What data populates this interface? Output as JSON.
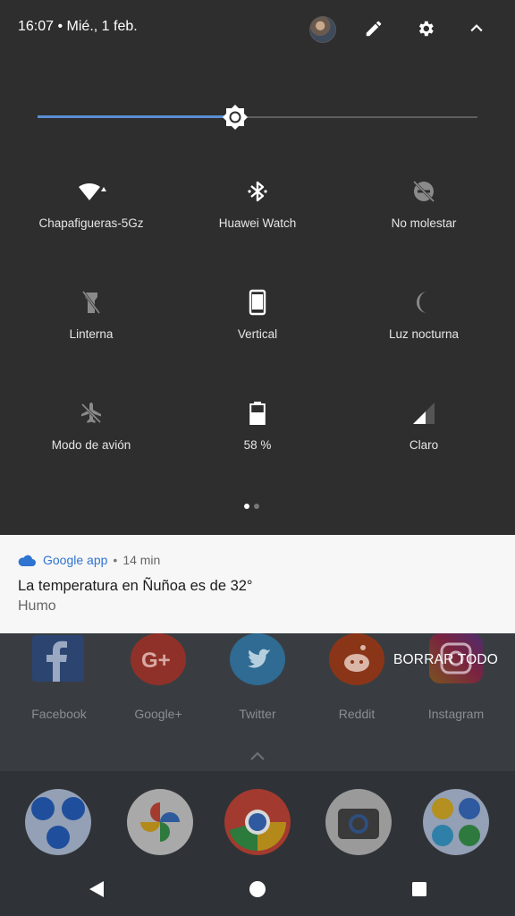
{
  "status_bar": {
    "time_date": "16:07 • Mié., 1 feb."
  },
  "brightness": {
    "level": 0.45
  },
  "tiles": [
    {
      "label": "Chapafigueras-5Gz",
      "icon": "wifi-icon"
    },
    {
      "label": "Huawei Watch",
      "icon": "bluetooth-icon"
    },
    {
      "label": "No molestar",
      "icon": "do-not-disturb-icon"
    },
    {
      "label": "Linterna",
      "icon": "flashlight-icon"
    },
    {
      "label": "Vertical",
      "icon": "rotation-icon"
    },
    {
      "label": "Luz nocturna",
      "icon": "night-light-icon"
    },
    {
      "label": "Modo de avión",
      "icon": "airplane-icon"
    },
    {
      "label": "58 %",
      "icon": "battery-icon"
    },
    {
      "label": "Claro",
      "icon": "cellular-signal-icon"
    }
  ],
  "page_indicator": {
    "current": 1,
    "total": 2
  },
  "notification": {
    "app": "Google app",
    "separator": "•",
    "time": "14 min",
    "title": "La temperatura en Ñuñoa es de 32°",
    "text": "Humo"
  },
  "home": {
    "apps": [
      "Facebook",
      "Google+",
      "Twitter",
      "Reddit",
      "Instagram"
    ],
    "clear_all": "BORRAR TODO"
  },
  "colors": {
    "accent": "#5b8fd6",
    "shade_bg": "#2e2e2e",
    "notification_app": "#2f74d0"
  }
}
